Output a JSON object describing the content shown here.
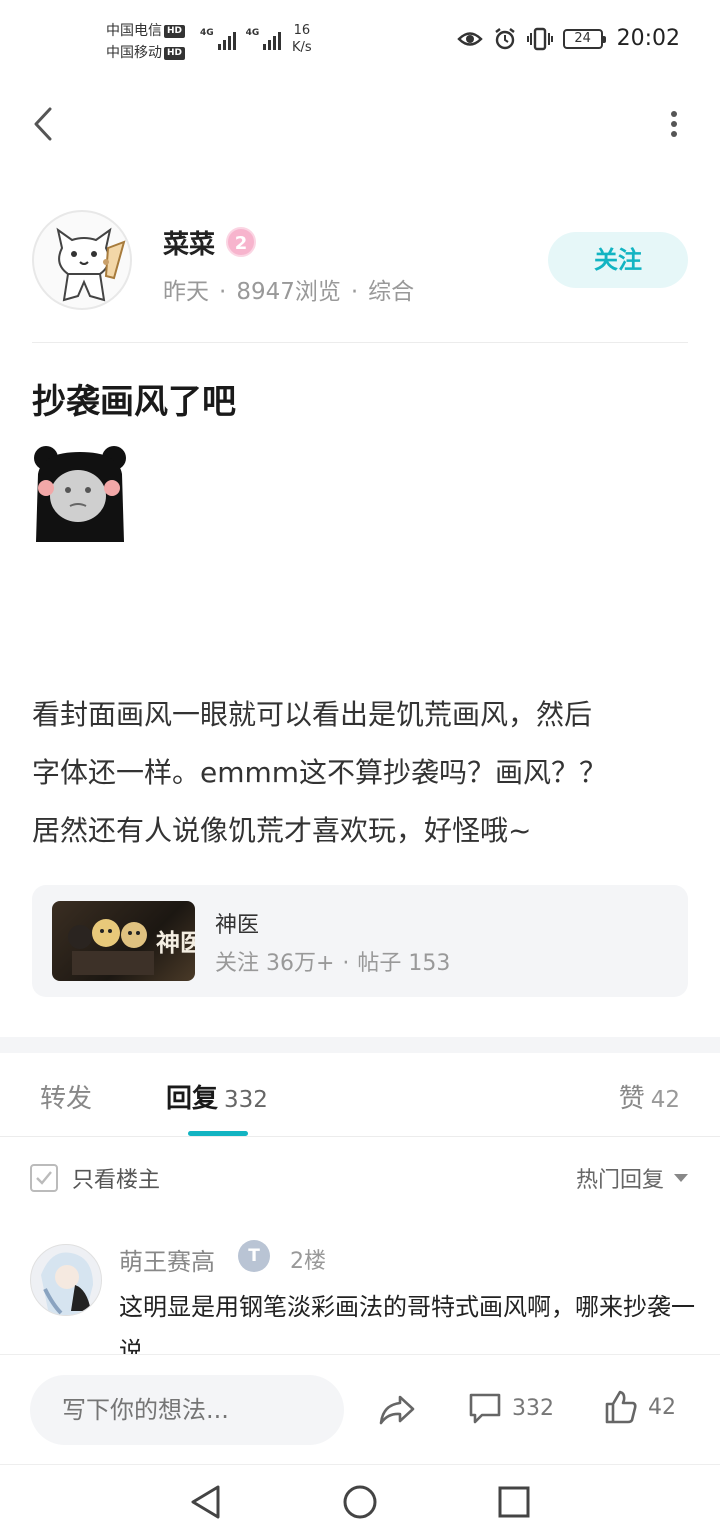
{
  "status_bar": {
    "carrier1": "中国电信",
    "carrier2": "中国移动",
    "hd": "HD",
    "network": "4G",
    "speed_value": "16",
    "speed_unit": "K/s",
    "battery": "24",
    "time": "20:02"
  },
  "post": {
    "author": "菜菜",
    "level": "2",
    "time": "昨天",
    "views": "8947浏览",
    "category": "综合",
    "follow_label": "关注",
    "title": "抄袭画风了吧",
    "body": [
      "看封面画风一眼就可以看出是饥荒画风，然后",
      "字体还一样。emmm这不算抄袭吗？画风？？",
      "居然还有人说像饥荒才喜欢玩，好怪哦~"
    ]
  },
  "game_card": {
    "name": "神医",
    "cover_text": "神医",
    "followers": "关注 36万+",
    "posts": "帖子 153"
  },
  "tabs": {
    "repost": "转发",
    "reply": "回复",
    "reply_count": "332",
    "like": "赞",
    "like_count": "42"
  },
  "filters": {
    "only_op": "只看楼主",
    "sort": "热门回复"
  },
  "comment": {
    "user": "萌王赛高",
    "badge": "T",
    "floor": "2楼",
    "text": "这明显是用钢笔淡彩画法的哥特式画风啊，哪来抄袭一说"
  },
  "bottom_bar": {
    "placeholder": "写下你的想法...",
    "comment_count": "332",
    "like_count": "42"
  },
  "icons": {
    "back": "back-arrow-icon",
    "more": "more-vertical-icon",
    "share": "share-icon",
    "comment": "comment-icon",
    "like": "thumbs-up-icon"
  },
  "colors": {
    "accent": "#12b4c2",
    "follow_bg": "#e6f7f8",
    "level_badge": "#f7b4cd"
  }
}
